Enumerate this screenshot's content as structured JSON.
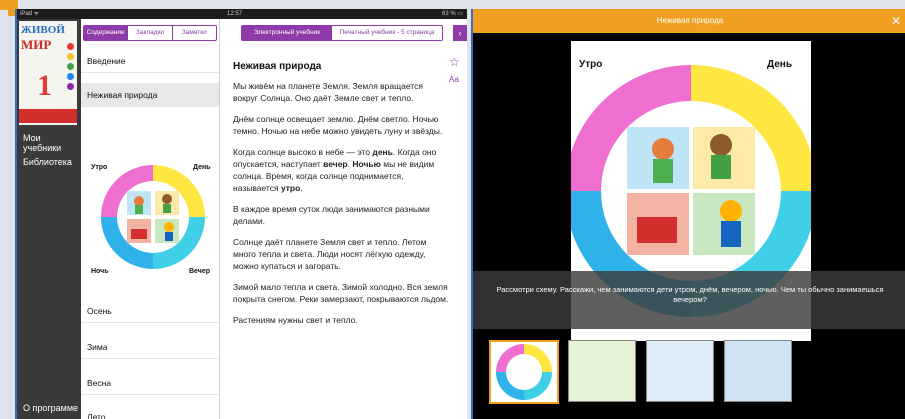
{
  "status_bar": {
    "carrier": "iPad ᯤ",
    "time": "12:57",
    "battery": "63 % ▭"
  },
  "book": {
    "title_line1": "ЖИВОЙ",
    "title_line2": "МИР",
    "grade": "1"
  },
  "sidebar": {
    "items": [
      {
        "label": "Мои учебники"
      },
      {
        "label": "Библиотека"
      }
    ],
    "about": "О программе"
  },
  "left_tabs": [
    {
      "label": "Содержание"
    },
    {
      "label": "Закладки"
    },
    {
      "label": "Заметки"
    }
  ],
  "toc": {
    "items": [
      {
        "label": "Введение"
      },
      {
        "label": "Неживая природа"
      }
    ],
    "lower_items": [
      {
        "label": "Осень"
      },
      {
        "label": "Зима"
      },
      {
        "label": "Весна"
      },
      {
        "label": "Лето"
      }
    ]
  },
  "diagram_labels": {
    "morning": "Утро",
    "day": "День",
    "evening": "Вечер",
    "night": "Ночь"
  },
  "right_tabs": {
    "active": "Электронный учебник",
    "inactive": "Печатный учебник - 5 страница"
  },
  "icons": {
    "back": "arrow-left-icon",
    "bookmark": "star-icon",
    "font": "font-size-icon",
    "close": "close-icon"
  },
  "article": {
    "title": "Неживая природа",
    "p1": "Мы живём на планете Земля. Земля вращается вокруг Солнца. Оно даёт Земле свет и тепло.",
    "p2": "Днём солнце освещает землю. Днём светло. Ночью темно. Ночью на небе можно увидеть луну и звёзды.",
    "p3_a": "Когда солнце высоко в небе — это ",
    "p3_b": "день",
    "p3_c": ". Когда оно опускается, наступает ",
    "p3_d": "вечер",
    "p3_e": ". ",
    "p3_f": "Ночью",
    "p3_g": " мы не видим солнца. Время, когда солнце поднимается, называется ",
    "p3_h": "утро",
    "p3_i": ".",
    "p4": "В каждое время суток люди занимаются разными делами.",
    "p5": "Солнце даёт планете Земля свет и тепло. Летом много тепла и света. Люди носят лёгкую одежду, можно купаться и загорать.",
    "p6": "Зимой мало тепла и света. Зимой холодно. Вся земля покрыта снегом. Реки замерзают, покрываются льдом.",
    "p7": "Растениям нужны свет и тепло."
  },
  "viewer": {
    "title": "Неживая природа",
    "caption": "Рассмотри схему. Расскажи, чем занимаются дети утром, днём, вечером, ночью. Чем ты обычно занимаешься вечером?"
  },
  "colors": {
    "accent": "#8e3aa8",
    "header": "#f0a020",
    "pink": "#ee6fd0",
    "yellow": "#ffe640",
    "blue": "#2fb2ea",
    "cyan": "#3fd0e8"
  }
}
